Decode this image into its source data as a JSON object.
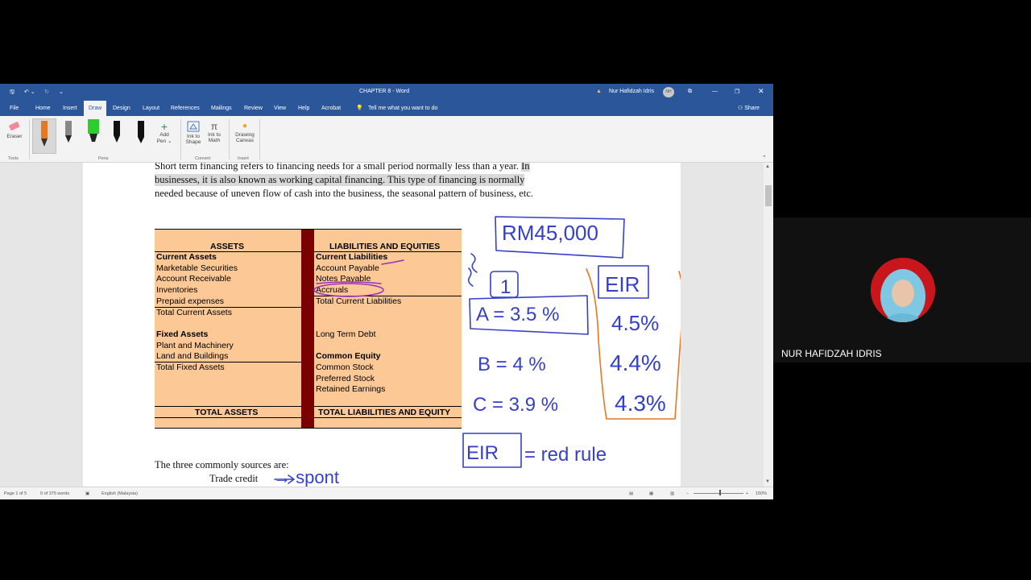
{
  "window": {
    "title": "CHAPTER 8  -  Word",
    "user": "Nur Hafidzah Idris",
    "user_initials": "NH",
    "share": "Share"
  },
  "menu": {
    "items": [
      "File",
      "Home",
      "Insert",
      "Draw",
      "Design",
      "Layout",
      "References",
      "Mailings",
      "Review",
      "View",
      "Help",
      "Acrobat"
    ],
    "tell_me": "Tell me what you want to do"
  },
  "ribbon": {
    "eraser": "Eraser",
    "add_pen": [
      "Add",
      "Pen ⌄"
    ],
    "ink_to_shape": [
      "Ink to",
      "Shape"
    ],
    "ink_to_math": [
      "Ink to",
      "Math"
    ],
    "drawing_canvas": [
      "Drawing",
      "Canvas"
    ],
    "groups": {
      "tools": "Tools",
      "pens": "Pens",
      "convert": "Convert",
      "insert": "Insert"
    }
  },
  "document": {
    "para_lines": [
      "Short term financing refers to financing needs for a small period normally less than a year.",
      "In",
      "businesses, it is also known as working capital financing. This type of financing is normally",
      "needed because of uneven flow of cash into the business, the seasonal pattern of business, etc."
    ],
    "three_sources": "The three commonly sources are:",
    "trade_credit": "Trade credit",
    "table": {
      "left_header": "ASSETS",
      "right_header": "LIABILITIES AND EQUITIES",
      "left_rows": [
        {
          "t": "Current Assets",
          "b": true
        },
        {
          "t": "Marketable Securities",
          "b": false
        },
        {
          "t": "Account Receivable",
          "b": false
        },
        {
          "t": "Inventories",
          "b": false
        },
        {
          "t": "Prepaid expenses",
          "b": false
        },
        {
          "t": "Total Current Assets",
          "b": false
        },
        {
          "t": "",
          "b": false
        },
        {
          "t": "Fixed Assets",
          "b": true
        },
        {
          "t": "Plant and Machinery",
          "b": false
        },
        {
          "t": "Land and Buildings",
          "b": false
        },
        {
          "t": "Total Fixed Assets",
          "b": false
        }
      ],
      "right_rows": [
        {
          "t": "Current Liabilities",
          "b": true
        },
        {
          "t": "Account Payable",
          "b": false
        },
        {
          "t": "Notes Payable",
          "b": false
        },
        {
          "t": "Accruals",
          "b": false
        },
        {
          "t": "Total Current Liabilities",
          "b": false
        },
        {
          "t": "",
          "b": false
        },
        {
          "t": "",
          "b": false
        },
        {
          "t": "Long Term Debt",
          "b": false
        },
        {
          "t": "",
          "b": false
        },
        {
          "t": "Common Equity",
          "b": true
        },
        {
          "t": "Common Stock",
          "b": false
        },
        {
          "t": "Preferred Stock",
          "b": false
        },
        {
          "t": "Retained Earnings",
          "b": false
        }
      ],
      "total_assets": "TOTAL ASSETS",
      "total_liab": "TOTAL LIABILITIES AND EQUITY"
    },
    "ink": {
      "amount": "RM45,000",
      "one": "1",
      "a": "A = 3.5 %",
      "b": "B = 4 %",
      "c": "C = 3.9 %",
      "eir": "EIR",
      "eir_vals": [
        "4.5%",
        "4.4%",
        "4.3%"
      ],
      "eir2": "EIR",
      "red_rule": "= red rule",
      "spont": "→ spont"
    }
  },
  "status": {
    "page": "Page 1 of 5",
    "words": "0 of 375 words",
    "lang": "English (Malaysia)",
    "zoom": "150%"
  },
  "participant": {
    "name": "NUR HAFIDZAH IDRIS"
  },
  "colors": {
    "word_blue": "#2b579a",
    "table_fill": "#fbc896",
    "table_bar": "#7a0000",
    "ink_blue": "#3640c8",
    "ink_orange": "#e87722",
    "ink_purple": "#9a2fc2"
  }
}
